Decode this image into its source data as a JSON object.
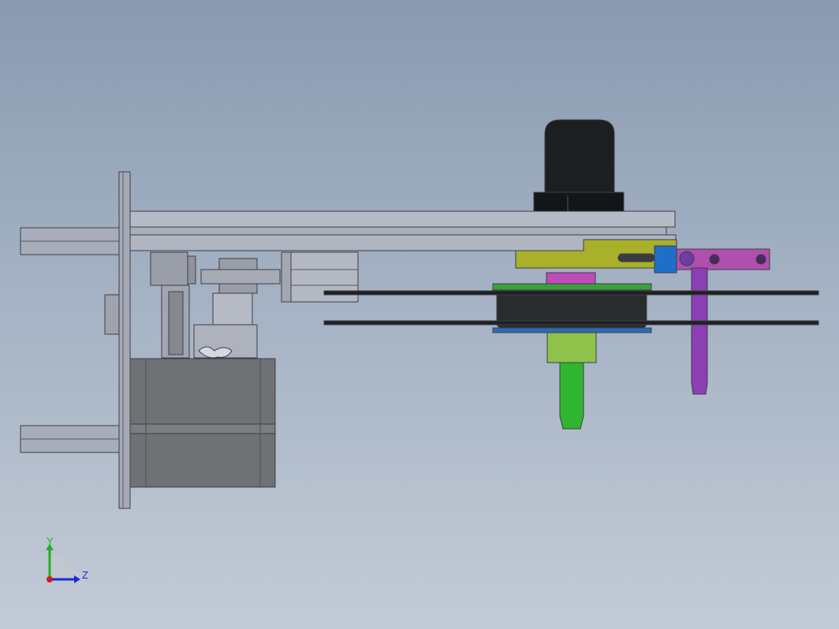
{
  "triad": {
    "y_label": "Y",
    "z_label": "Z",
    "y_color": "#1fb01f",
    "z_color": "#1a2ad6",
    "x_color": "#c81e1e"
  },
  "colors": {
    "plate": "#b3b8c6",
    "plate_edge": "#4a4d57",
    "motor_body": "#6d6f72",
    "motor_cap": "#1c1d1f",
    "bracket_yellow": "#a9b02a",
    "nozzle_green": "#2fb52f",
    "collar_green": "#8fc24a",
    "pin_purple": "#8d3eb4",
    "block_blue": "#1f6fc8",
    "clamp_magenta": "#b14fae",
    "pulley_dark": "#2a2b2d"
  }
}
